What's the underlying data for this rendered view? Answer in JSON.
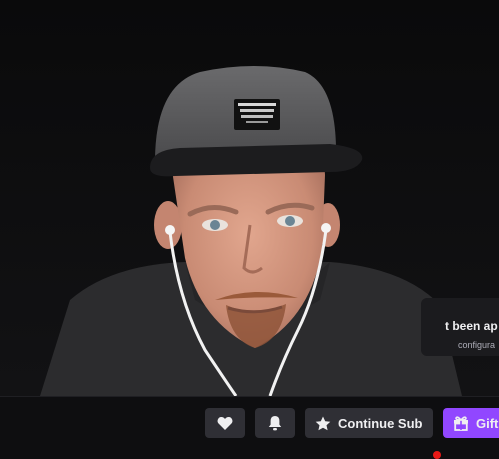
{
  "player": {
    "notification": {
      "title": "t been ap",
      "subtitle": "configura"
    }
  },
  "actions": {
    "like_icon": "heart-icon",
    "notify_icon": "bell-icon",
    "subscribe": {
      "icon": "star-icon",
      "label": "Continue Sub"
    },
    "gift": {
      "icon": "gift-icon",
      "label": "Gift"
    }
  },
  "colors": {
    "background": "#0e0e10",
    "button": "#2f2f35",
    "brand_purple": "#9147ff",
    "text": "#efeff1"
  }
}
